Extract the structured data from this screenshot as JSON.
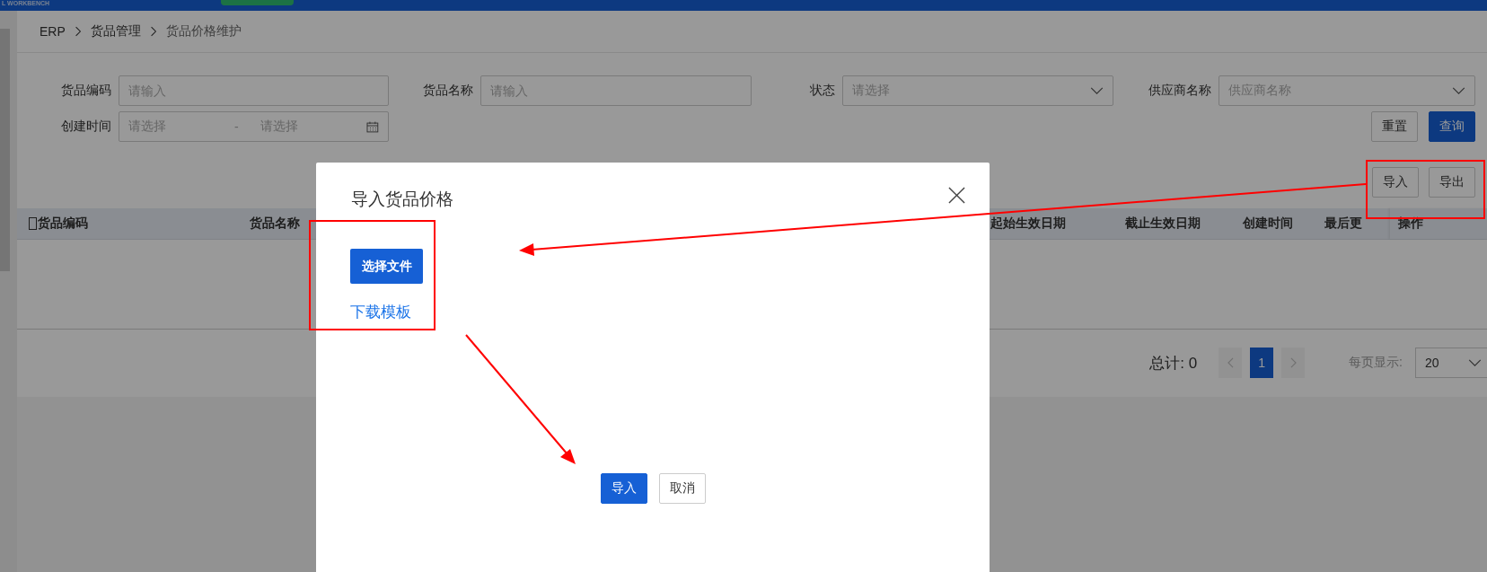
{
  "header": {
    "brand": "L WORKBENCH"
  },
  "breadcrumb": [
    "ERP",
    "货品管理",
    "货品价格维护"
  ],
  "filters": [
    {
      "label": "货品编码",
      "kind": "input",
      "placeholder": "请输入"
    },
    {
      "label": "货品名称",
      "kind": "input",
      "placeholder": "请输入"
    },
    {
      "label": "状态",
      "kind": "select",
      "placeholder": "请选择"
    },
    {
      "label": "供应商名称",
      "kind": "select",
      "placeholder": "供应商名称"
    },
    {
      "label": "创建时间",
      "kind": "daterange",
      "placeholder": "请选择",
      "placeholder_end": "请选择",
      "separator": "-"
    }
  ],
  "filter_buttons": [
    {
      "label": "重置",
      "primary": false
    },
    {
      "label": "查询",
      "primary": true
    }
  ],
  "toolbar_buttons": [
    "导入",
    "导出"
  ],
  "table": {
    "columns": [
      "货品编码",
      "货品名称",
      "起始生效日期",
      "截止生效日期",
      "创建时间",
      "最后更",
      "操作"
    ]
  },
  "pagination": {
    "total": "总计: 0",
    "pages": [
      {
        "label": "1",
        "selected": true
      }
    ],
    "page_size_label": "每页显示:",
    "page_size": "20"
  },
  "modal": {
    "title": "导入货品价格",
    "choose_file": "选择文件",
    "download_link": "下载模板",
    "buttons": [
      {
        "label": "导入",
        "primary": true
      },
      {
        "label": "取消",
        "primary": false
      }
    ]
  }
}
